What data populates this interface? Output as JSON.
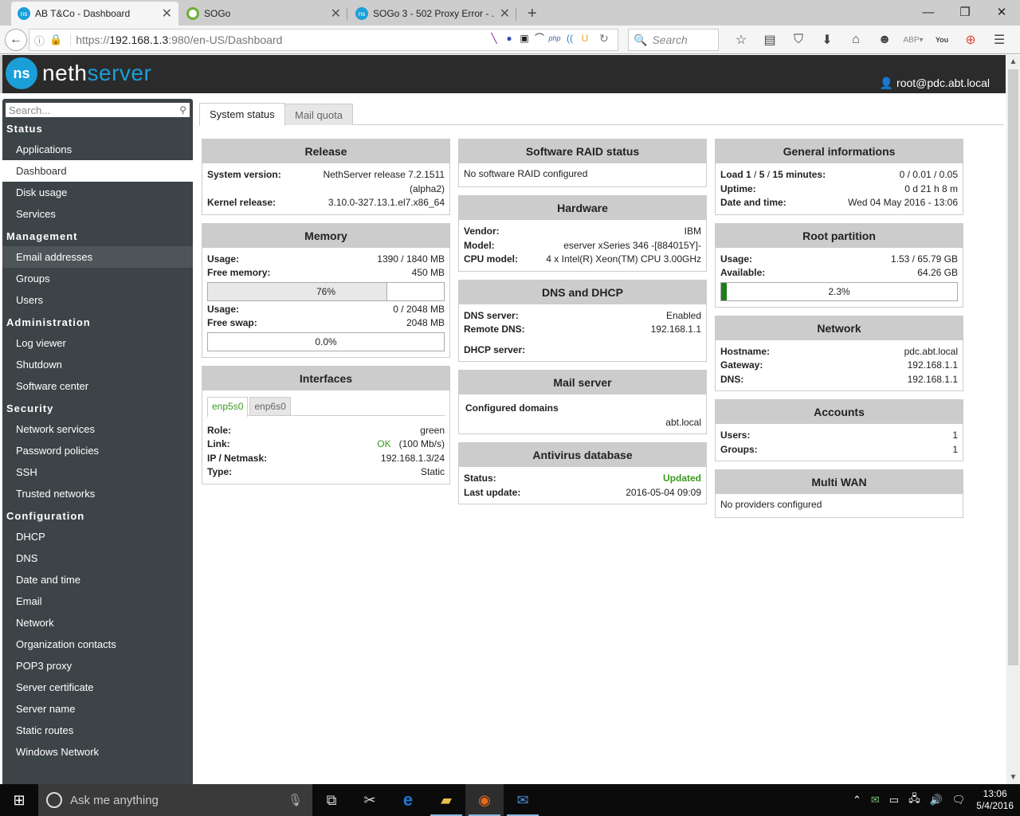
{
  "browser": {
    "tabs": [
      {
        "title": "AB T&Co - Dashboard",
        "icon": "nethserver-favicon",
        "active": true
      },
      {
        "title": "SOGo",
        "icon": "sogo-favicon",
        "active": false
      },
      {
        "title": "SOGo 3 - 502 Proxy Error - ...",
        "icon": "nethserver-favicon",
        "active": false
      }
    ],
    "new_tab": "+",
    "url_prefix": "https://",
    "url_host": "192.168.1.3",
    "url_rest": ":980/en-US/Dashboard",
    "search_placeholder": "Search"
  },
  "header": {
    "logo_mark": "ns",
    "logo_word1": "neth",
    "logo_word2": "server",
    "user": "root@pdc.abt.local"
  },
  "sidebar": {
    "search_placeholder": "Search...",
    "sections": [
      {
        "title": "Status",
        "items": [
          "Applications",
          "Dashboard",
          "Disk usage",
          "Services"
        ]
      },
      {
        "title": "Management",
        "items": [
          "Email addresses",
          "Groups",
          "Users"
        ]
      },
      {
        "title": "Administration",
        "items": [
          "Log viewer",
          "Shutdown",
          "Software center"
        ]
      },
      {
        "title": "Security",
        "items": [
          "Network services",
          "Password policies",
          "SSH",
          "Trusted networks"
        ]
      },
      {
        "title": "Configuration",
        "items": [
          "DHCP",
          "DNS",
          "Date and time",
          "Email",
          "Network",
          "Organization contacts",
          "POP3 proxy",
          "Server certificate",
          "Server name",
          "Static routes",
          "Windows Network"
        ]
      }
    ],
    "active_item": "Dashboard",
    "hover_item": "Email addresses"
  },
  "main": {
    "tabs": [
      "System status",
      "Mail quota"
    ],
    "release": {
      "title": "Release",
      "system_version_label": "System version:",
      "system_version_value": "NethServer release 7.2.1511",
      "system_version_value2": "(alpha2)",
      "kernel_label": "Kernel release:",
      "kernel_value": "3.10.0-327.13.1.el7.x86_64"
    },
    "memory": {
      "title": "Memory",
      "usage_label": "Usage:",
      "usage_value": "1390 / 1840 MB",
      "free_label": "Free memory:",
      "free_value": "450 MB",
      "mem_percent": 76,
      "mem_percent_label": "76%",
      "swap_usage_label": "Usage:",
      "swap_usage_value": "0 / 2048 MB",
      "swap_free_label": "Free swap:",
      "swap_free_value": "2048 MB",
      "swap_percent": 0,
      "swap_percent_label": "0.0%"
    },
    "interfaces": {
      "title": "Interfaces",
      "tabs": [
        "enp5s0",
        "enp6s0"
      ],
      "role_label": "Role:",
      "role_value": "green",
      "link_label": "Link:",
      "link_status": "OK",
      "link_speed": "(100 Mb/s)",
      "ip_label": "IP / Netmask:",
      "ip_value": "192.168.1.3/24",
      "type_label": "Type:",
      "type_value": "Static"
    },
    "raid": {
      "title": "Software RAID status",
      "text": "No software RAID configured"
    },
    "hardware": {
      "title": "Hardware",
      "vendor_label": "Vendor:",
      "vendor_value": "IBM",
      "model_label": "Model:",
      "model_value": "eserver xSeries 346 -[884015Y]-",
      "cpu_label": "CPU model:",
      "cpu_value": "4 x Intel(R) Xeon(TM) CPU 3.00GHz"
    },
    "dns_dhcp": {
      "title": "DNS and DHCP",
      "dns_label": "DNS server:",
      "dns_value": "Enabled",
      "remote_label": "Remote DNS:",
      "remote_value": "192.168.1.1",
      "dhcp_label": "DHCP server:",
      "dhcp_value": ""
    },
    "mail": {
      "title": "Mail server",
      "domains_label": "Configured domains",
      "domains_value": "abt.local"
    },
    "antivirus": {
      "title": "Antivirus database",
      "status_label": "Status:",
      "status_value": "Updated",
      "last_label": "Last update:",
      "last_value": "2016-05-04 09:09"
    },
    "general": {
      "title": "General informations",
      "load_label_a": "Load ",
      "load_1": "1",
      "load_sep1": " / ",
      "load_5": "5",
      "load_sep2": " / ",
      "load_15": "15",
      "load_label_b": " minutes:",
      "load_value": "0 / 0.01 / 0.05",
      "uptime_label": "Uptime:",
      "uptime_value": "0 d 21 h 8 m",
      "date_label": "Date and time:",
      "date_value": "Wed 04 May 2016 - 13:06"
    },
    "root": {
      "title": "Root partition",
      "usage_label": "Usage:",
      "usage_value": "1.53 / 65.79 GB",
      "avail_label": "Available:",
      "avail_value": "64.26 GB",
      "percent": 2.3,
      "percent_label": "2.3%"
    },
    "network": {
      "title": "Network",
      "host_label": "Hostname:",
      "host_value": "pdc.abt.local",
      "gw_label": "Gateway:",
      "gw_value": "192.168.1.1",
      "dns_label": "DNS:",
      "dns_value": "192.168.1.1"
    },
    "accounts": {
      "title": "Accounts",
      "users_label": "Users:",
      "users_value": "1",
      "groups_label": "Groups:",
      "groups_value": "1"
    },
    "multiwan": {
      "title": "Multi WAN",
      "text": "No providers configured"
    }
  },
  "taskbar": {
    "cortana_placeholder": "Ask me anything",
    "time": "13:06",
    "date": "5/4/2016"
  },
  "colors": {
    "accent": "#1a9fd9",
    "ok_green": "#3a9b20",
    "sidebar_bg": "#3d4447",
    "header_bg": "#2b2b2b",
    "bar_green": "#1e7e1e"
  }
}
